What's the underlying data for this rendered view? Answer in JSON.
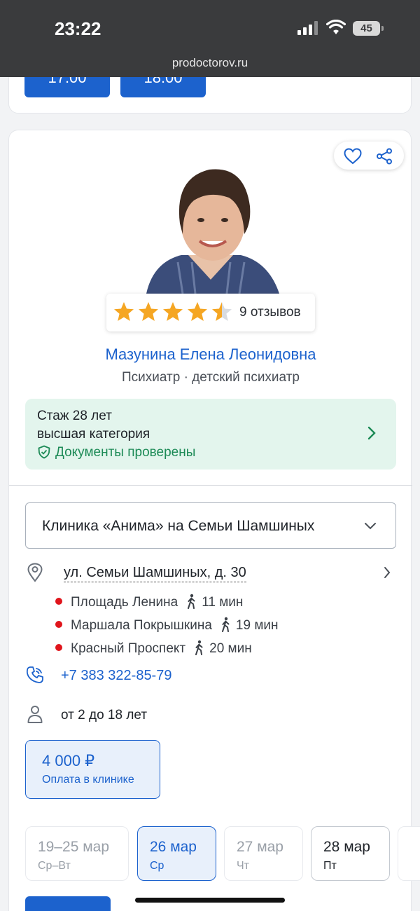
{
  "status_bar": {
    "time": "23:22",
    "battery": "45",
    "url": "prodoctorov.ru"
  },
  "prev_slots": [
    "17:00",
    "18:00"
  ],
  "doctor": {
    "name": "Мазунина Елена Леонидовна",
    "specialty": "Психиатр · детский психиатр",
    "rating_stars": 4.5,
    "reviews": "9 отзывов",
    "experience": "Стаж 28 лет",
    "category": "высшая категория",
    "verified": "Документы проверены"
  },
  "clinic": {
    "name": "Клиника «Анима» на Семьи Шамшиных",
    "address": "ул. Семьи Шамшиных, д. 30",
    "metro": [
      {
        "station": "Площадь Ленина",
        "walk": "11 мин"
      },
      {
        "station": "Маршала Покрышкина",
        "walk": "19 мин"
      },
      {
        "station": "Красный Проспект",
        "walk": "20 мин"
      }
    ],
    "phone": "+7 383 322-85-79",
    "ages": "от 2 до 18 лет"
  },
  "price": {
    "amount": "4 000 ₽",
    "note": "Оплата в клинике"
  },
  "dates": [
    {
      "date": "19–25 мар",
      "day": "Ср–Вт"
    },
    {
      "date": "26 мар",
      "day": "Ср"
    },
    {
      "date": "27 мар",
      "day": "Чт"
    },
    {
      "date": "28 мар",
      "day": "Пт"
    }
  ],
  "colors": {
    "accent": "#1c62cd",
    "verified_green": "#1c8a56",
    "star": "#f5a623",
    "metro_dot": "#e0151c"
  }
}
